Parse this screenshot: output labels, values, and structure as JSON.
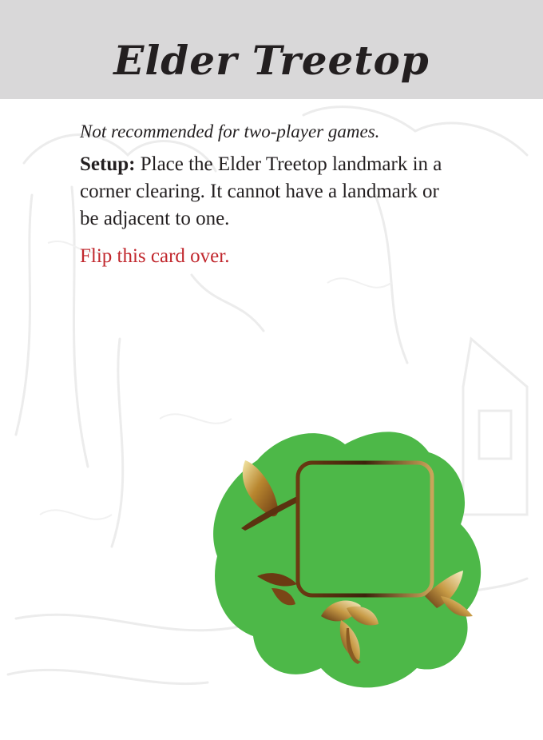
{
  "card": {
    "title": "Elder Treetop",
    "note": "Not recommended for two-player games.",
    "setup_label": "Setup:",
    "setup_text": "Place the Elder Treetop landmark in a corner clearing. It cannot have a landmark or be adjacent to one.",
    "flip_text": "Flip this card over."
  },
  "colors": {
    "header_bg": "#d9d8d9",
    "title_text": "#231f20",
    "flip_text": "#c1272d",
    "clearing_green": "#4db848",
    "gold_light": "#f4e9a8",
    "gold_dark": "#6b3a12"
  },
  "icons": {
    "background": "forest-sketch-watermark",
    "illustration": "elder-treetop-clearing-icon"
  }
}
